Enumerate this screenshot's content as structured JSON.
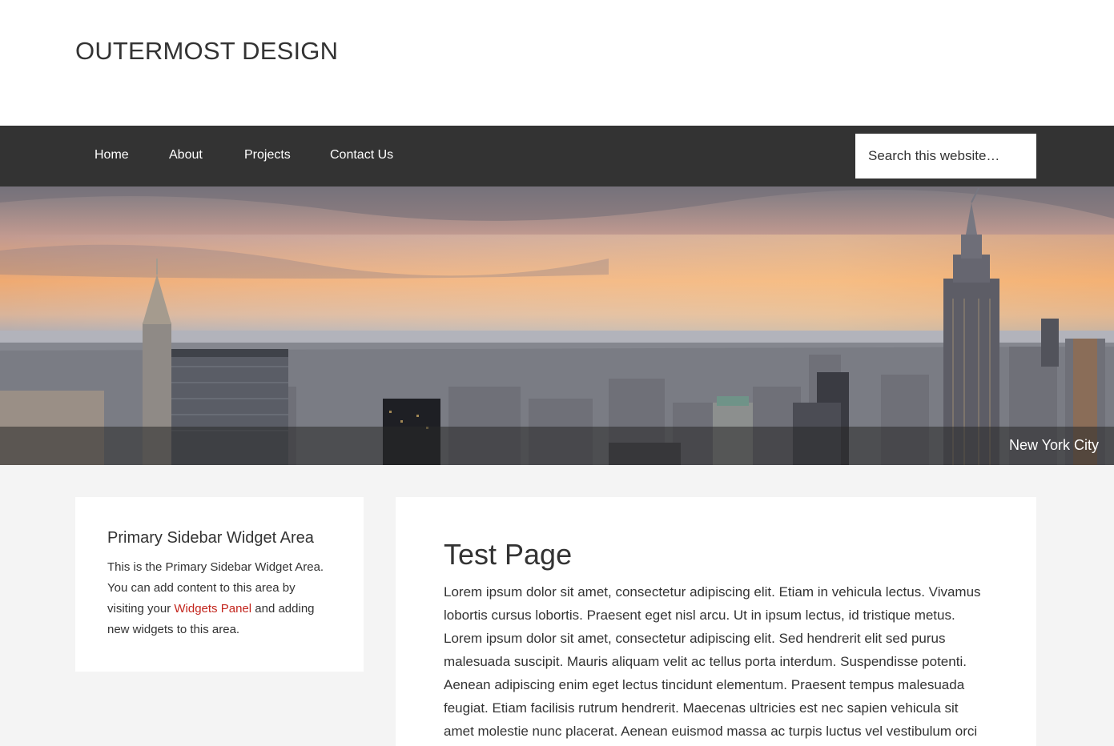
{
  "header": {
    "site_title": "OUTERMOST DESIGN"
  },
  "nav": {
    "items": [
      {
        "label": "Home"
      },
      {
        "label": "About"
      },
      {
        "label": "Projects"
      },
      {
        "label": "Contact Us"
      }
    ],
    "search_placeholder": "Search this website…"
  },
  "hero": {
    "caption": "New York City"
  },
  "sidebar": {
    "widget_title": "Primary Sidebar Widget Area",
    "text_before": "This is the Primary Sidebar Widget Area. You can add content to this area by visiting your ",
    "link_label": "Widgets Panel",
    "text_after": " and adding new widgets to this area."
  },
  "content": {
    "title": "Test Page",
    "body": "Lorem ipsum dolor sit amet, consectetur adipiscing elit. Etiam in vehicula lectus. Vivamus lobortis cursus lobortis. Praesent eget nisl arcu. Ut in ipsum lectus, id tristique metus. Lorem ipsum dolor sit amet, consectetur adipiscing elit. Sed hendrerit elit sed purus malesuada suscipit. Mauris aliquam velit ac tellus porta interdum. Suspendisse potenti. Aenean adipiscing enim eget lectus tincidunt elementum. Praesent tempus malesuada feugiat. Etiam facilisis rutrum hendrerit. Maecenas ultricies est nec sapien vehicula sit amet molestie nunc placerat. Aenean euismod massa ac turpis luctus vel vestibulum orci"
  },
  "colors": {
    "nav_background": "#333333",
    "page_background": "#f4f4f4",
    "link": "#c3251d"
  }
}
